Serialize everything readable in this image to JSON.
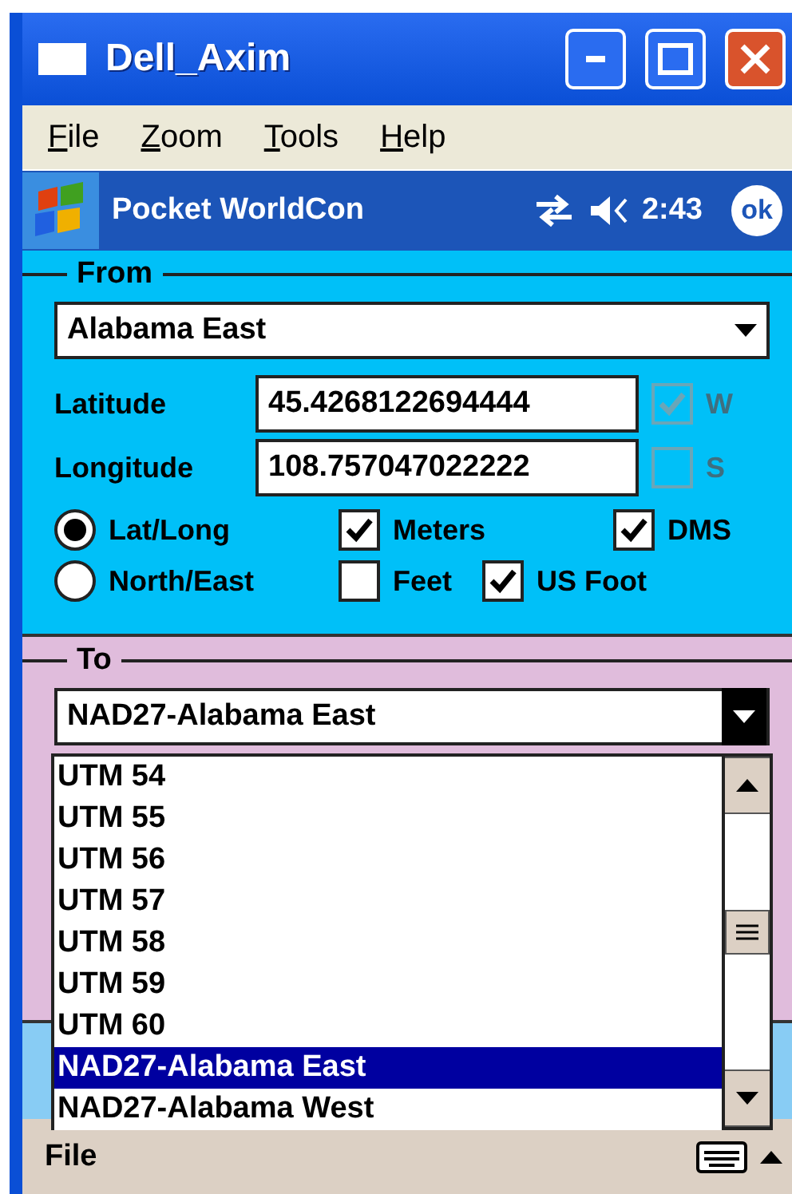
{
  "window": {
    "title": "Dell_Axim"
  },
  "menu": [
    "File",
    "Zoom",
    "Tools",
    "Help"
  ],
  "app_bar": {
    "title": "Pocket WorldCon",
    "time": "2:43",
    "ok": "ok"
  },
  "from": {
    "legend": "From",
    "datum": "Alabama East",
    "fields": [
      {
        "label": "Latitude",
        "value": "45.4268122694444"
      },
      {
        "label": "Longitude",
        "value": "108.757047022222"
      }
    ],
    "hemispheres": [
      {
        "label": "W",
        "checked": true,
        "disabled": true
      },
      {
        "label": "S",
        "checked": false,
        "disabled": true
      }
    ],
    "modes": [
      {
        "label": "Lat/Long",
        "selected": true
      },
      {
        "label": "North/East",
        "selected": false
      }
    ],
    "units": [
      {
        "label": "Meters",
        "checked": true
      },
      {
        "label": "DMS",
        "checked": true
      },
      {
        "label": "Feet",
        "checked": false
      },
      {
        "label": "US Foot",
        "checked": true
      }
    ]
  },
  "to": {
    "legend": "To",
    "datum": "NAD27-Alabama East",
    "options": [
      {
        "label": "UTM 54",
        "selected": false
      },
      {
        "label": "UTM 55",
        "selected": false
      },
      {
        "label": "UTM 56",
        "selected": false
      },
      {
        "label": "UTM 57",
        "selected": false
      },
      {
        "label": "UTM 58",
        "selected": false
      },
      {
        "label": "UTM 59",
        "selected": false
      },
      {
        "label": "UTM 60",
        "selected": false
      },
      {
        "label": "NAD27-Alabama East",
        "selected": true
      },
      {
        "label": "NAD27-Alabama West",
        "selected": false
      }
    ]
  },
  "bottom_bar": {
    "menu": "File"
  }
}
